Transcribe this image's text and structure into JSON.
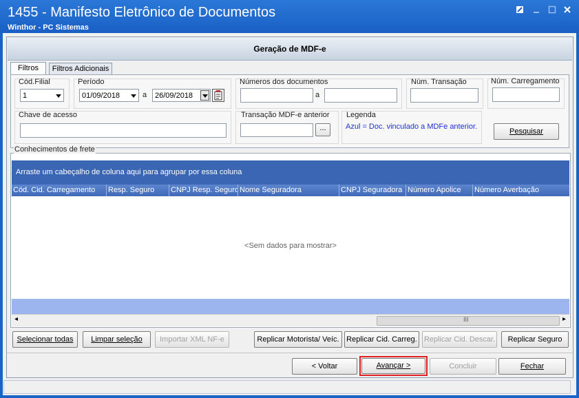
{
  "window": {
    "title": "1455 - Manifesto Eletrônico de Documentos",
    "subtitle": "Winthor - PC Sistemas"
  },
  "header": {
    "title": "Geração de MDF-e"
  },
  "tabs": [
    {
      "label": "Filtros",
      "active": true
    },
    {
      "label": "Filtros Adicionais",
      "active": false
    }
  ],
  "filters": {
    "cod_filial": {
      "label": "Cód.Filial",
      "value": "1"
    },
    "periodo": {
      "label": "Período",
      "start": "01/09/2018",
      "sep": "a",
      "end": "26/09/2018"
    },
    "numeros_documentos": {
      "label": "Números dos documentos",
      "sep": "a",
      "from": "",
      "to": ""
    },
    "num_transacao": {
      "label": "Núm. Transação",
      "value": ""
    },
    "num_carregamento": {
      "label": "Núm. Carregamento",
      "value": ""
    },
    "chave_acesso": {
      "label": "Chave de acesso",
      "value": ""
    },
    "transacao_anterior": {
      "label": "Transação MDF-e anterior",
      "value": "",
      "browse": "..."
    },
    "legenda": {
      "label": "Legenda",
      "text": "Azul = Doc. vinculado a MDFe anterior.",
      "color": "#1f2fd6"
    },
    "pesquisar": "Pesquisar"
  },
  "grid": {
    "group_label": "Conhecimentos de frete",
    "group_hint": "Arraste um cabeçalho de coluna aqui para agrupar por essa coluna",
    "columns": [
      "Cód. Cid. Carregamento",
      "Resp. Seguro",
      "CNPJ Resp. Seguro",
      "Nome Seguradora",
      "CNPJ Seguradora",
      "Número Apolice",
      "Número Averbação"
    ],
    "empty_text": "<Sem dados para mostrar>",
    "scroll_left": "◂",
    "scroll_right": "▸",
    "scroll_grip": "III"
  },
  "actions": {
    "selecionar_todas": "Selecionar todas",
    "limpar_selecao": "Limpar seleção",
    "importar_xml": "Importar XML NF-e",
    "replicar_motorista": "Replicar Motorista/ Veíc.",
    "replicar_cid_carreg": "Replicar Cid. Carreg.",
    "replicar_cid_descar": "Replicar Cid. Descar.",
    "replicar_seguro": "Replicar Seguro"
  },
  "nav": {
    "voltar": "< Voltar",
    "avancar": "Avançar >",
    "concluir": "Concluir",
    "fechar": "Fechar"
  },
  "colors": {
    "titlebar": "#1a5fc4",
    "grid_group": "#3b66b4",
    "grid_footer": "#9db5ef",
    "highlight": "#e02020"
  }
}
